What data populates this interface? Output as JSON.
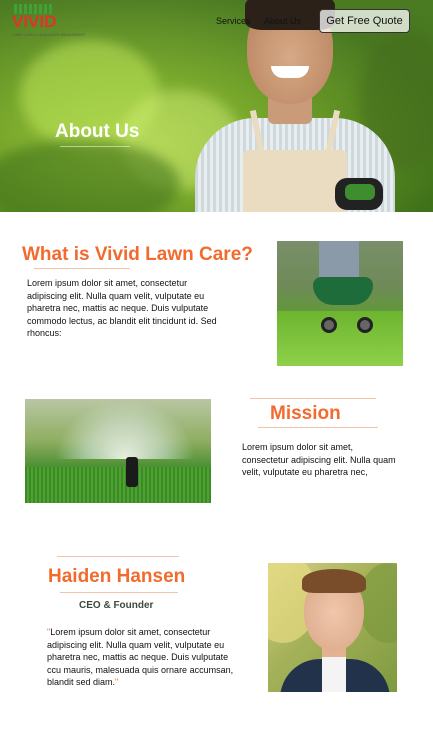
{
  "brand": {
    "name": "VIVID",
    "tagline": "LAWN CARE & LANDSCAPE MANAGEMENT"
  },
  "nav": {
    "links": [
      "Services",
      "About Us"
    ],
    "cta_label": "Get Free Quote"
  },
  "hero": {
    "title": "About Us"
  },
  "about": {
    "heading": "What is Vivid Lawn Care?",
    "body": "Lorem ipsum dolor sit amet, consectetur adipiscing elit. Nulla quam velit, vulputate eu pharetra nec, mattis ac neque. Duis vulputate commodo lectus, ac blandit elit tincidunt id. Sed rhoncus:"
  },
  "mission": {
    "heading": "Mission",
    "body": "Lorem ipsum dolor sit amet, consectetur adipiscing elit. Nulla quam velit, vulputate eu pharetra nec,"
  },
  "founder": {
    "name": "Haiden Hansen",
    "role": "CEO & Founder",
    "quote_open": "\"",
    "quote": "Lorem ipsum dolor sit amet, consectetur adipiscing elit. Nulla quam velit, vulputate eu pharetra nec, mattis ac neque. Duis vulputate ccu mauris, malesuada quis ornare accumsan, blandit sed diam.",
    "quote_close": "\""
  },
  "colors": {
    "accent": "#f26a2e",
    "logo_red": "#e0332b",
    "logo_green": "#3fa13a"
  }
}
